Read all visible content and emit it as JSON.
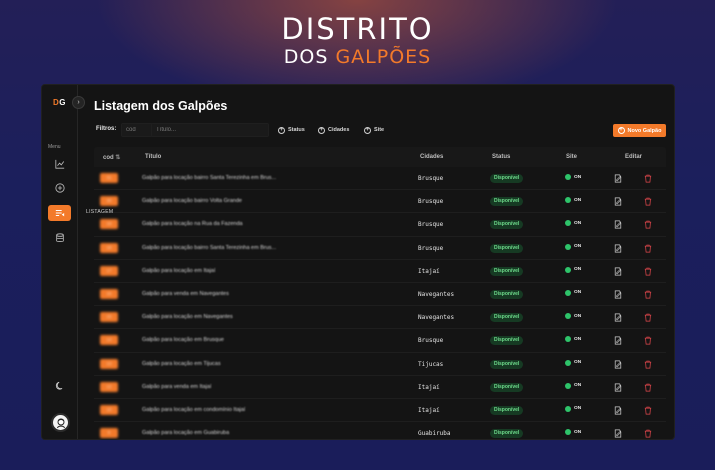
{
  "brand": {
    "line1": "DISTRITO",
    "line2_white": "DOS ",
    "line2_orange": "GALPÕES"
  },
  "colors": {
    "accent": "#f37a2a",
    "background": "#1b1f5a",
    "panel": "#141414",
    "status_green": "#2ec46a",
    "delete_red": "#e5484d"
  },
  "sidebar": {
    "logo_d": "D",
    "logo_g": "G",
    "collapse_icon": "chevron-right-icon",
    "menu_label": "Menu",
    "items": [
      {
        "icon": "chart-line-icon",
        "active": false
      },
      {
        "icon": "plus-circle-icon",
        "active": false
      },
      {
        "icon": "list-edit-icon",
        "active": true,
        "tooltip": "LISTAGEM"
      },
      {
        "icon": "database-icon",
        "active": false
      }
    ],
    "theme_icon": "moon-icon",
    "avatar_icon": "user-avatar-icon"
  },
  "page": {
    "title": "Listagem dos Galpões"
  },
  "filters": {
    "label": "Filtros:",
    "cod_placeholder": "cod",
    "title_placeholder": "Título...",
    "status_label": "Status",
    "cities_label": "Cidades",
    "site_label": "Site",
    "new_button": "Novo Galpão"
  },
  "table": {
    "headers": {
      "cod": "cod",
      "title": "Título",
      "city": "Cidades",
      "status": "Status",
      "site": "Site",
      "edit": "Editar"
    },
    "rows": [
      {
        "cod": "31",
        "title": "Galpão para locação bairro Santa Terezinha em Brus...",
        "city": "Brusque",
        "status": "Disponível",
        "site": "ON"
      },
      {
        "cod": "30",
        "title": "Galpão para locação bairro Volta Grande",
        "city": "Brusque",
        "status": "Disponível",
        "site": "ON"
      },
      {
        "cod": "19",
        "title": "Galpão para locação na Rua da Fazenda",
        "city": "Brusque",
        "status": "Disponível",
        "site": "ON"
      },
      {
        "cod": "18",
        "title": "Galpão para locação bairro Santa Terezinha em Brus...",
        "city": "Brusque",
        "status": "Disponível",
        "site": "ON"
      },
      {
        "cod": "17",
        "title": "Galpão para locação em Itajaí",
        "city": "Itajaí",
        "status": "Disponível",
        "site": "ON"
      },
      {
        "cod": "16",
        "title": "Galpão para venda em Navegantes",
        "city": "Navegantes",
        "status": "Disponível",
        "site": "ON"
      },
      {
        "cod": "15",
        "title": "Galpão para locação em Navegantes",
        "city": "Navegantes",
        "status": "Disponível",
        "site": "ON"
      },
      {
        "cod": "14",
        "title": "Galpão para locação em Brusque",
        "city": "Brusque",
        "status": "Disponível",
        "site": "ON"
      },
      {
        "cod": "13",
        "title": "Galpão para locação em Tijucas",
        "city": "Tijucas",
        "status": "Disponível",
        "site": "ON"
      },
      {
        "cod": "12",
        "title": "Galpão para venda em Itajaí",
        "city": "Itajaí",
        "status": "Disponível",
        "site": "ON"
      },
      {
        "cod": "10",
        "title": "Galpão para locação em condomínio Itajaí",
        "city": "Itajaí",
        "status": "Disponível",
        "site": "ON"
      },
      {
        "cod": "9",
        "title": "Galpão para locação em Guabiruba",
        "city": "Guabiruba",
        "status": "Disponível",
        "site": "ON"
      }
    ]
  }
}
